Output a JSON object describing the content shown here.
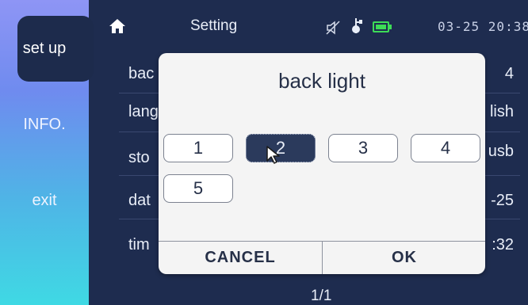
{
  "sidebar": {
    "items": [
      {
        "label": "set up",
        "selected": true
      },
      {
        "label": "INFO.",
        "selected": false
      },
      {
        "label": "exit",
        "selected": false
      }
    ]
  },
  "header": {
    "title": "Setting",
    "clock": "03-25 20:38",
    "icons": [
      "home-icon",
      "mute-icon",
      "usb-icon",
      "battery-icon"
    ]
  },
  "settings_list": {
    "rows": [
      {
        "label": "bac",
        "value": "4"
      },
      {
        "label": "lang",
        "value": "lish"
      },
      {
        "label": "sto",
        "value": "usb"
      },
      {
        "label": "dat",
        "value": "-25"
      },
      {
        "label": "tim",
        "value": ":32"
      }
    ],
    "pager": "1/1"
  },
  "dialog": {
    "title": "back light",
    "options": [
      "1",
      "2",
      "3",
      "4",
      "5"
    ],
    "selected": "2",
    "cancel_label": "CANCEL",
    "ok_label": "OK"
  },
  "colors": {
    "background": "#1e2c4f",
    "sidebar_top": "#8e95f5",
    "sidebar_bottom": "#3fd9e4",
    "dialog": "#f4f4f4",
    "selected_option": "#2b3a5c",
    "battery": "#3ddc57"
  }
}
